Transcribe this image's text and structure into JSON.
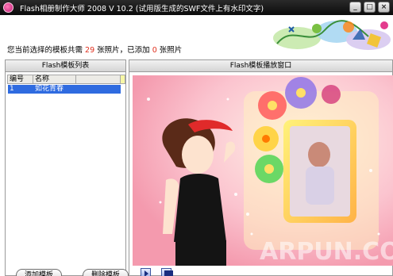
{
  "window": {
    "title": "Flash相册制作大师 2008 V 10.2 (试用版生成的SWF文件上有水印文字)",
    "minimize_glyph": "_",
    "maximize_glyph": "□",
    "close_glyph": "×"
  },
  "info": {
    "prefix": "您当前选择的模板共需",
    "required_count": "29",
    "mid": "张照片，已添加",
    "added_count": "0",
    "suffix": "张照片"
  },
  "template_list": {
    "title": "Flash模板列表",
    "columns": [
      "编号",
      "名称"
    ],
    "rows": [
      {
        "num": "1",
        "name": "如花青春"
      }
    ],
    "add_button": "添加模板",
    "delete_button": "删除模板"
  },
  "preview": {
    "title": "Flash模板播放窗口",
    "watermark": "ARPUN.COM"
  },
  "colors": {
    "count_red": "#e0301e",
    "selection_blue": "#2f6be0",
    "preview_pink": "#f7a8b8"
  },
  "icons": {
    "app": "app-flower-icon",
    "play": "play-icon",
    "stop": "stop-icon"
  }
}
